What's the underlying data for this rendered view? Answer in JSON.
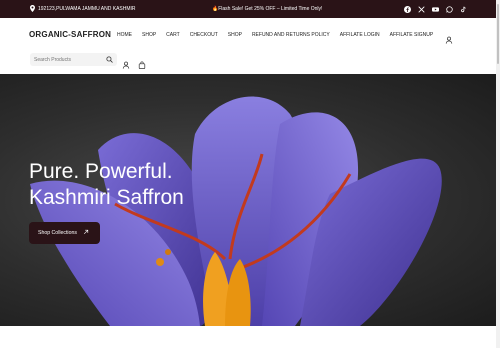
{
  "topbar": {
    "location_text": "192123,PULWAMA JAMMU AND KASHMIR",
    "promo_text": "🔥Flash Sale! Get 25% OFF – Limited Time Only!",
    "socials": [
      "facebook-icon",
      "x-icon",
      "youtube-icon",
      "whatsapp-icon",
      "tiktok-icon"
    ]
  },
  "header": {
    "logo": "ORGANIC-SAFFRON",
    "nav": [
      "HOME",
      "SHOP",
      "CART",
      "CHECKOUT",
      "SHOP",
      "REFUND AND RETURNS POLICY",
      "AFFILATE LOGIN",
      "AFFILATE SIGNUP"
    ],
    "search_placeholder": "Search Products"
  },
  "hero": {
    "title_line1": "Pure. Powerful.",
    "title_line2": "Kashmiri Saffron",
    "button_label": "Shop Collections"
  },
  "colors": {
    "brand_dark": "#2a1317",
    "petal": "#6b5fc7",
    "stigma": "#c23a1e",
    "stamen": "#f0a020"
  }
}
